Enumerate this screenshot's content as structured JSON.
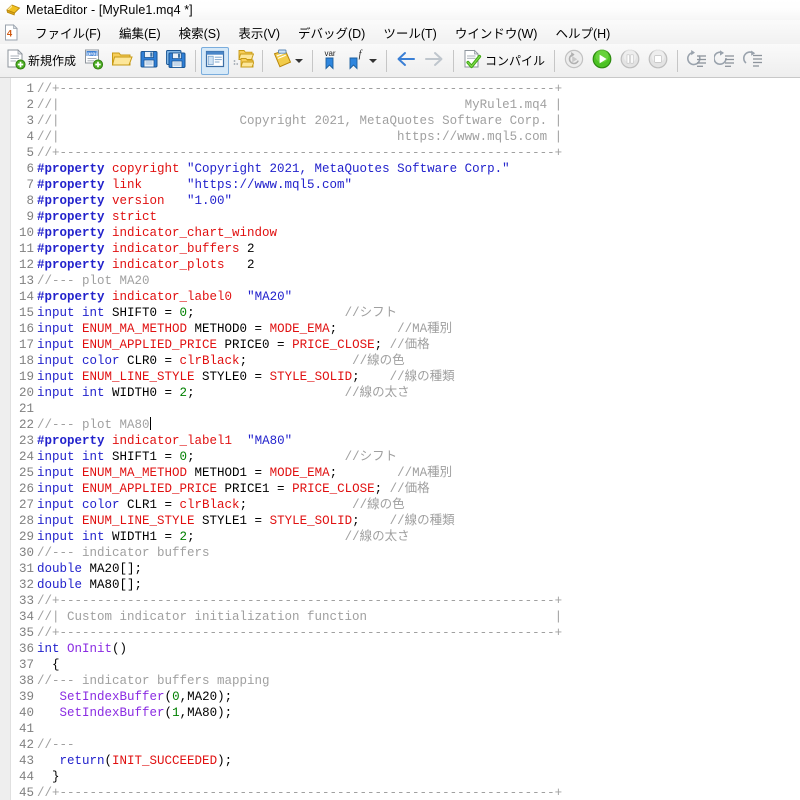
{
  "window": {
    "title": "MetaEditor - [MyRule1.mq4 *]",
    "app_icon": "metaeditor-diamond-icon"
  },
  "menubar": {
    "doc_icon": "mq4-document-icon",
    "items": [
      {
        "label": "ファイル(F)",
        "name": "menu-file"
      },
      {
        "label": "編集(E)",
        "name": "menu-edit"
      },
      {
        "label": "検索(S)",
        "name": "menu-search"
      },
      {
        "label": "表示(V)",
        "name": "menu-view"
      },
      {
        "label": "デバッグ(D)",
        "name": "menu-debug"
      },
      {
        "label": "ツール(T)",
        "name": "menu-tools"
      },
      {
        "label": "ウインドウ(W)",
        "name": "menu-window"
      },
      {
        "label": "ヘルプ(H)",
        "name": "menu-help"
      }
    ]
  },
  "toolbar": {
    "new_label": "新規作成",
    "compile_label": "コンパイル",
    "buttons": [
      {
        "name": "new-file-button",
        "icon": "new-document-icon"
      },
      {
        "name": "new-project-button",
        "icon": "new-project-icon"
      },
      {
        "name": "open-button",
        "icon": "open-folder-icon"
      },
      {
        "name": "save-button",
        "icon": "floppy-save-icon"
      },
      {
        "name": "save-all-button",
        "icon": "floppy-save-all-icon"
      },
      {
        "name": "navigator-toggle-button",
        "icon": "navigator-panel-icon"
      },
      {
        "name": "toolbox-button",
        "icon": "folder-dotted-icon"
      },
      {
        "name": "clipboard-button",
        "icon": "clipboard-notes-icon"
      },
      {
        "name": "watch-variable-button",
        "icon": "var-bookmark-icon"
      },
      {
        "name": "function-bookmark-button",
        "icon": "function-bookmark-icon"
      },
      {
        "name": "back-button",
        "icon": "arrow-left-icon"
      },
      {
        "name": "forward-button",
        "icon": "arrow-right-icon"
      },
      {
        "name": "compile-button",
        "icon": "compile-check-icon"
      },
      {
        "name": "debug-history-button",
        "icon": "debug-rewind-icon"
      },
      {
        "name": "start-button",
        "icon": "play-green-icon"
      },
      {
        "name": "pause-button",
        "icon": "pause-icon"
      },
      {
        "name": "stop-button",
        "icon": "stop-icon"
      },
      {
        "name": "step-into-button",
        "icon": "step-into-icon"
      },
      {
        "name": "step-over-button",
        "icon": "step-over-icon"
      },
      {
        "name": "step-out-button",
        "icon": "step-out-icon"
      }
    ]
  },
  "editor": {
    "first_line_number": 1,
    "last_line_number": 45,
    "cursor_line": 22,
    "cursor_column": 15,
    "line_numbers": [
      1,
      2,
      3,
      4,
      5,
      6,
      7,
      8,
      9,
      10,
      11,
      12,
      13,
      14,
      15,
      16,
      17,
      18,
      19,
      20,
      21,
      22,
      23,
      24,
      25,
      26,
      27,
      28,
      29,
      30,
      31,
      32,
      33,
      34,
      35,
      36,
      37,
      38,
      39,
      40,
      41,
      42,
      43,
      44,
      45
    ],
    "lines": [
      [
        {
          "t": "//+------------------------------------------------------------------+",
          "c": "cmt"
        }
      ],
      [
        {
          "t": "//|                                                      MyRule1.mq4 |",
          "c": "cmt"
        }
      ],
      [
        {
          "t": "//|                        Copyright 2021, MetaQuotes Software Corp. |",
          "c": "cmt"
        }
      ],
      [
        {
          "t": "//|                                             https://www.mql5.com |",
          "c": "cmt"
        }
      ],
      [
        {
          "t": "//+------------------------------------------------------------------+",
          "c": "cmt"
        }
      ],
      [
        {
          "t": "#property ",
          "c": "pre"
        },
        {
          "t": "copyright ",
          "c": "prop"
        },
        {
          "t": "\"Copyright 2021, MetaQuotes Software Corp.\"",
          "c": "str"
        }
      ],
      [
        {
          "t": "#property ",
          "c": "pre"
        },
        {
          "t": "link      ",
          "c": "prop"
        },
        {
          "t": "\"https://www.mql5.com\"",
          "c": "str"
        }
      ],
      [
        {
          "t": "#property ",
          "c": "pre"
        },
        {
          "t": "version   ",
          "c": "prop"
        },
        {
          "t": "\"1.00\"",
          "c": "str"
        }
      ],
      [
        {
          "t": "#property ",
          "c": "pre"
        },
        {
          "t": "strict",
          "c": "prop"
        }
      ],
      [
        {
          "t": "#property ",
          "c": "pre"
        },
        {
          "t": "indicator_chart_window",
          "c": "prop"
        }
      ],
      [
        {
          "t": "#property ",
          "c": "pre"
        },
        {
          "t": "indicator_buffers ",
          "c": "prop"
        },
        {
          "t": "2",
          "c": "plain"
        }
      ],
      [
        {
          "t": "#property ",
          "c": "pre"
        },
        {
          "t": "indicator_plots   ",
          "c": "prop"
        },
        {
          "t": "2",
          "c": "plain"
        }
      ],
      [
        {
          "t": "//--- plot MA20",
          "c": "cmt"
        }
      ],
      [
        {
          "t": "#property ",
          "c": "pre"
        },
        {
          "t": "indicator_label0",
          "c": "prop"
        },
        {
          "t": "  ",
          "c": "plain"
        },
        {
          "t": "\"MA20\"",
          "c": "str"
        }
      ],
      [
        {
          "t": "input ",
          "c": "kw"
        },
        {
          "t": "int ",
          "c": "kw"
        },
        {
          "t": "SHIFT0 = ",
          "c": "plain"
        },
        {
          "t": "0",
          "c": "num"
        },
        {
          "t": ";",
          "c": "plain"
        },
        {
          "t": "                    ",
          "c": "plain"
        },
        {
          "t": "//シフト",
          "c": "cmt"
        }
      ],
      [
        {
          "t": "input ",
          "c": "kw"
        },
        {
          "t": "ENUM_MA_METHOD ",
          "c": "type"
        },
        {
          "t": "METHOD0 = ",
          "c": "plain"
        },
        {
          "t": "MODE_EMA",
          "c": "const"
        },
        {
          "t": ";",
          "c": "plain"
        },
        {
          "t": "        ",
          "c": "plain"
        },
        {
          "t": "//MA種別",
          "c": "cmt"
        }
      ],
      [
        {
          "t": "input ",
          "c": "kw"
        },
        {
          "t": "ENUM_APPLIED_PRICE ",
          "c": "type"
        },
        {
          "t": "PRICE0 = ",
          "c": "plain"
        },
        {
          "t": "PRICE_CLOSE",
          "c": "const"
        },
        {
          "t": "; ",
          "c": "plain"
        },
        {
          "t": "//価格",
          "c": "cmt"
        }
      ],
      [
        {
          "t": "input ",
          "c": "kw"
        },
        {
          "t": "color ",
          "c": "kw"
        },
        {
          "t": "CLR0 = ",
          "c": "plain"
        },
        {
          "t": "clrBlack",
          "c": "const"
        },
        {
          "t": ";",
          "c": "plain"
        },
        {
          "t": "              ",
          "c": "plain"
        },
        {
          "t": "//線の色",
          "c": "cmt"
        }
      ],
      [
        {
          "t": "input ",
          "c": "kw"
        },
        {
          "t": "ENUM_LINE_STYLE ",
          "c": "type"
        },
        {
          "t": "STYLE0 = ",
          "c": "plain"
        },
        {
          "t": "STYLE_SOLID",
          "c": "const"
        },
        {
          "t": ";",
          "c": "plain"
        },
        {
          "t": "    ",
          "c": "plain"
        },
        {
          "t": "//線の種類",
          "c": "cmt"
        }
      ],
      [
        {
          "t": "input ",
          "c": "kw"
        },
        {
          "t": "int ",
          "c": "kw"
        },
        {
          "t": "WIDTH0 = ",
          "c": "plain"
        },
        {
          "t": "2",
          "c": "num"
        },
        {
          "t": ";",
          "c": "plain"
        },
        {
          "t": "                    ",
          "c": "plain"
        },
        {
          "t": "//線の太さ",
          "c": "cmt"
        }
      ],
      [
        {
          "t": "",
          "c": "plain"
        }
      ],
      [
        {
          "t": "//--- plot MA80",
          "c": "cmt"
        }
      ],
      [
        {
          "t": "#property ",
          "c": "pre"
        },
        {
          "t": "indicator_label1",
          "c": "prop"
        },
        {
          "t": "  ",
          "c": "plain"
        },
        {
          "t": "\"MA80\"",
          "c": "str"
        }
      ],
      [
        {
          "t": "input ",
          "c": "kw"
        },
        {
          "t": "int ",
          "c": "kw"
        },
        {
          "t": "SHIFT1 = ",
          "c": "plain"
        },
        {
          "t": "0",
          "c": "num"
        },
        {
          "t": ";",
          "c": "plain"
        },
        {
          "t": "                    ",
          "c": "plain"
        },
        {
          "t": "//シフト",
          "c": "cmt"
        }
      ],
      [
        {
          "t": "input ",
          "c": "kw"
        },
        {
          "t": "ENUM_MA_METHOD ",
          "c": "type"
        },
        {
          "t": "METHOD1 = ",
          "c": "plain"
        },
        {
          "t": "MODE_EMA",
          "c": "const"
        },
        {
          "t": ";",
          "c": "plain"
        },
        {
          "t": "        ",
          "c": "plain"
        },
        {
          "t": "//MA種別",
          "c": "cmt"
        }
      ],
      [
        {
          "t": "input ",
          "c": "kw"
        },
        {
          "t": "ENUM_APPLIED_PRICE ",
          "c": "type"
        },
        {
          "t": "PRICE1 = ",
          "c": "plain"
        },
        {
          "t": "PRICE_CLOSE",
          "c": "const"
        },
        {
          "t": "; ",
          "c": "plain"
        },
        {
          "t": "//価格",
          "c": "cmt"
        }
      ],
      [
        {
          "t": "input ",
          "c": "kw"
        },
        {
          "t": "color ",
          "c": "kw"
        },
        {
          "t": "CLR1 = ",
          "c": "plain"
        },
        {
          "t": "clrBlack",
          "c": "const"
        },
        {
          "t": ";",
          "c": "plain"
        },
        {
          "t": "              ",
          "c": "plain"
        },
        {
          "t": "//線の色",
          "c": "cmt"
        }
      ],
      [
        {
          "t": "input ",
          "c": "kw"
        },
        {
          "t": "ENUM_LINE_STYLE ",
          "c": "type"
        },
        {
          "t": "STYLE1 = ",
          "c": "plain"
        },
        {
          "t": "STYLE_SOLID",
          "c": "const"
        },
        {
          "t": ";",
          "c": "plain"
        },
        {
          "t": "    ",
          "c": "plain"
        },
        {
          "t": "//線の種類",
          "c": "cmt"
        }
      ],
      [
        {
          "t": "input ",
          "c": "kw"
        },
        {
          "t": "int ",
          "c": "kw"
        },
        {
          "t": "WIDTH1 = ",
          "c": "plain"
        },
        {
          "t": "2",
          "c": "num"
        },
        {
          "t": ";",
          "c": "plain"
        },
        {
          "t": "                    ",
          "c": "plain"
        },
        {
          "t": "//線の太さ",
          "c": "cmt"
        }
      ],
      [
        {
          "t": "//--- indicator buffers",
          "c": "cmt"
        }
      ],
      [
        {
          "t": "double ",
          "c": "kw"
        },
        {
          "t": "MA20[];",
          "c": "plain"
        }
      ],
      [
        {
          "t": "double ",
          "c": "kw"
        },
        {
          "t": "MA80[];",
          "c": "plain"
        }
      ],
      [
        {
          "t": "//+------------------------------------------------------------------+",
          "c": "cmt"
        }
      ],
      [
        {
          "t": "//| Custom indicator initialization function                         |",
          "c": "cmt"
        }
      ],
      [
        {
          "t": "//+------------------------------------------------------------------+",
          "c": "cmt"
        }
      ],
      [
        {
          "t": "int ",
          "c": "kw"
        },
        {
          "t": "OnInit",
          "c": "fn"
        },
        {
          "t": "()",
          "c": "plain"
        }
      ],
      [
        {
          "t": "  {",
          "c": "plain"
        }
      ],
      [
        {
          "t": "//--- indicator buffers mapping",
          "c": "cmt"
        }
      ],
      [
        {
          "t": "   ",
          "c": "plain"
        },
        {
          "t": "SetIndexBuffer",
          "c": "fn"
        },
        {
          "t": "(",
          "c": "plain"
        },
        {
          "t": "0",
          "c": "num"
        },
        {
          "t": ",MA20);",
          "c": "plain"
        }
      ],
      [
        {
          "t": "   ",
          "c": "plain"
        },
        {
          "t": "SetIndexBuffer",
          "c": "fn"
        },
        {
          "t": "(",
          "c": "plain"
        },
        {
          "t": "1",
          "c": "num"
        },
        {
          "t": ",MA80);",
          "c": "plain"
        }
      ],
      [
        {
          "t": "",
          "c": "plain"
        }
      ],
      [
        {
          "t": "//---",
          "c": "cmt"
        }
      ],
      [
        {
          "t": "   ",
          "c": "plain"
        },
        {
          "t": "return",
          "c": "kw"
        },
        {
          "t": "(",
          "c": "plain"
        },
        {
          "t": "INIT_SUCCEEDED",
          "c": "const"
        },
        {
          "t": ");",
          "c": "plain"
        }
      ],
      [
        {
          "t": "  }",
          "c": "plain"
        }
      ],
      [
        {
          "t": "//+------------------------------------------------------------------+",
          "c": "cmt"
        }
      ]
    ]
  },
  "colors": {
    "comment": "#a0a0a0",
    "preprocessor": "#2222cc",
    "property": "#e01010",
    "string": "#2222cc",
    "keyword": "#2222cc",
    "number": "#008000",
    "function": "#8a2be2",
    "constant": "#e01010",
    "gutter_text": "#808080",
    "editor_bg": "#ffffff",
    "marker_strip": "#eeeeee"
  }
}
